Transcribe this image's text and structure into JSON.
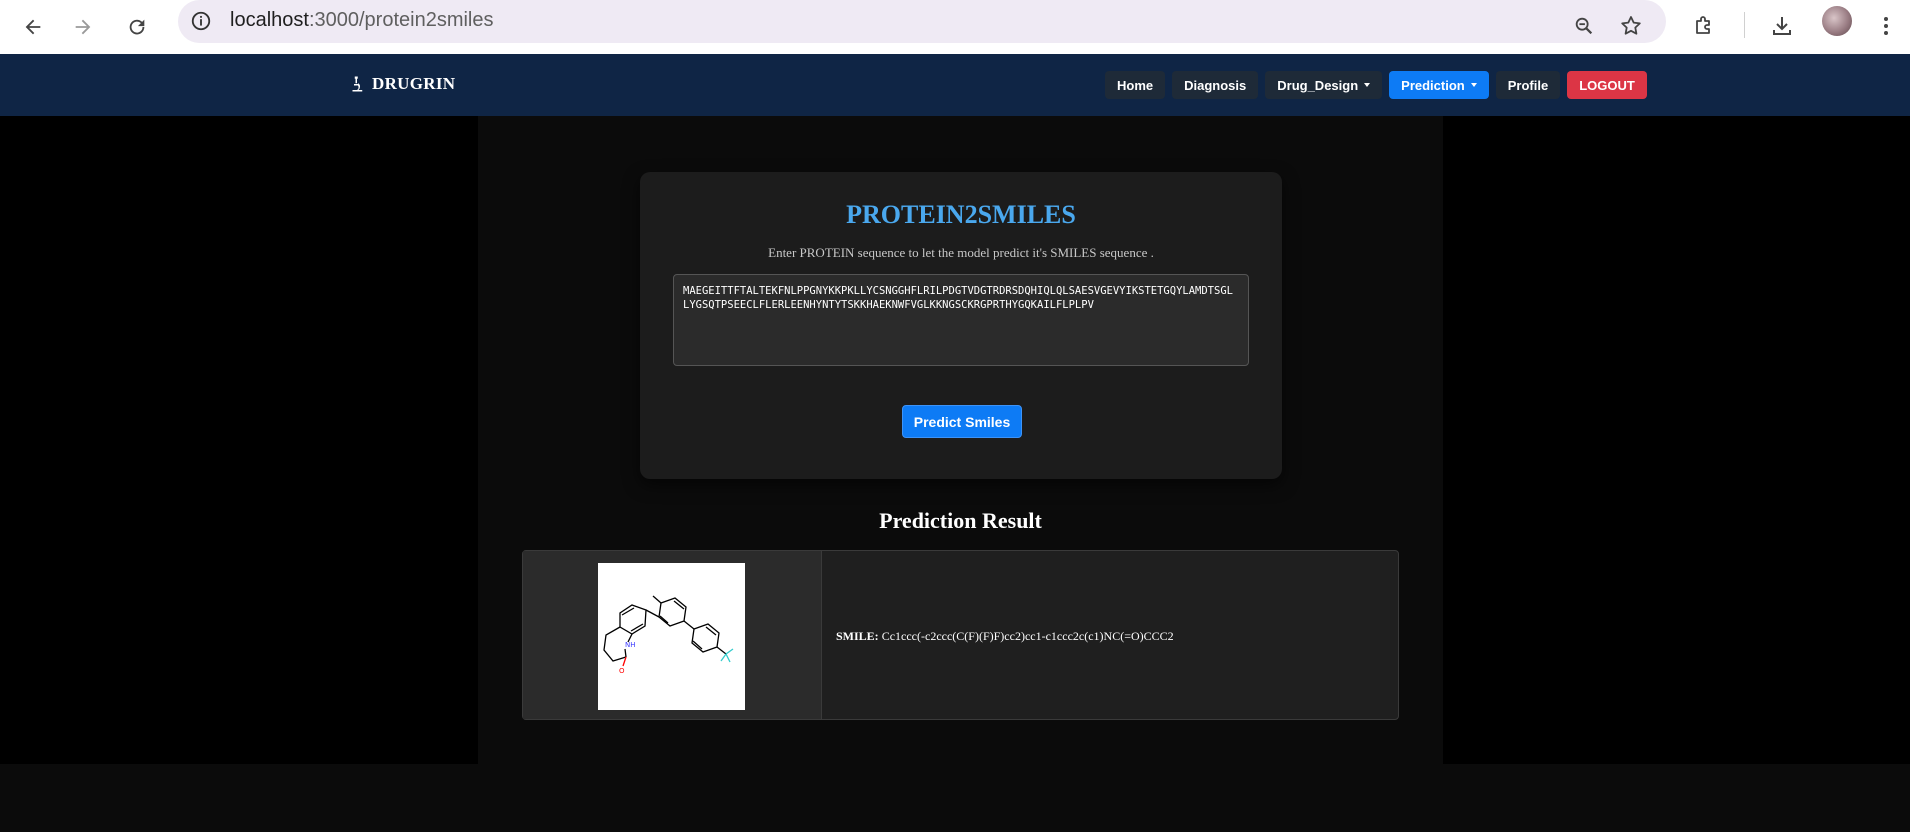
{
  "browser": {
    "url_host": "localhost",
    "url_rest": ":3000/protein2smiles"
  },
  "nav": {
    "brand": "DRUGRIN",
    "items": [
      {
        "label": "Home"
      },
      {
        "label": "Diagnosis"
      },
      {
        "label": "Drug_Design"
      },
      {
        "label": "Prediction"
      },
      {
        "label": "Profile"
      },
      {
        "label": "LOGOUT"
      }
    ]
  },
  "form": {
    "title": "PROTEIN2SMILES",
    "subtitle": "Enter PROTEIN sequence to let the model predict it's SMILES sequence .",
    "sequence": "MAEGEITTFTALTEKFNLPPGNYKKPKLLYCSNGGHFLRILPDGTVDGTRDRSDQHIQLQLSAESVGEVYIKSTETGQYLAMDTSGLLYGSQTPSEECLFLERLEENHYNTYTSKKHAEKNWFVGLKKNGSCKRGPRTHYGQKAILFLPLPV",
    "button_label": "Predict Smiles"
  },
  "result": {
    "title": "Prediction Result",
    "smile_label": "SMILE:",
    "smile_value": "Cc1ccc(-c2ccc(C(F)(F)F)cc2)cc1-c1ccc2c(c1)NC(=O)CCC2"
  },
  "colors": {
    "navbar_bg": "#0f2545",
    "accent": "#0d7bf5",
    "title_blue": "#4aa8ee",
    "logout": "#dc3545"
  }
}
